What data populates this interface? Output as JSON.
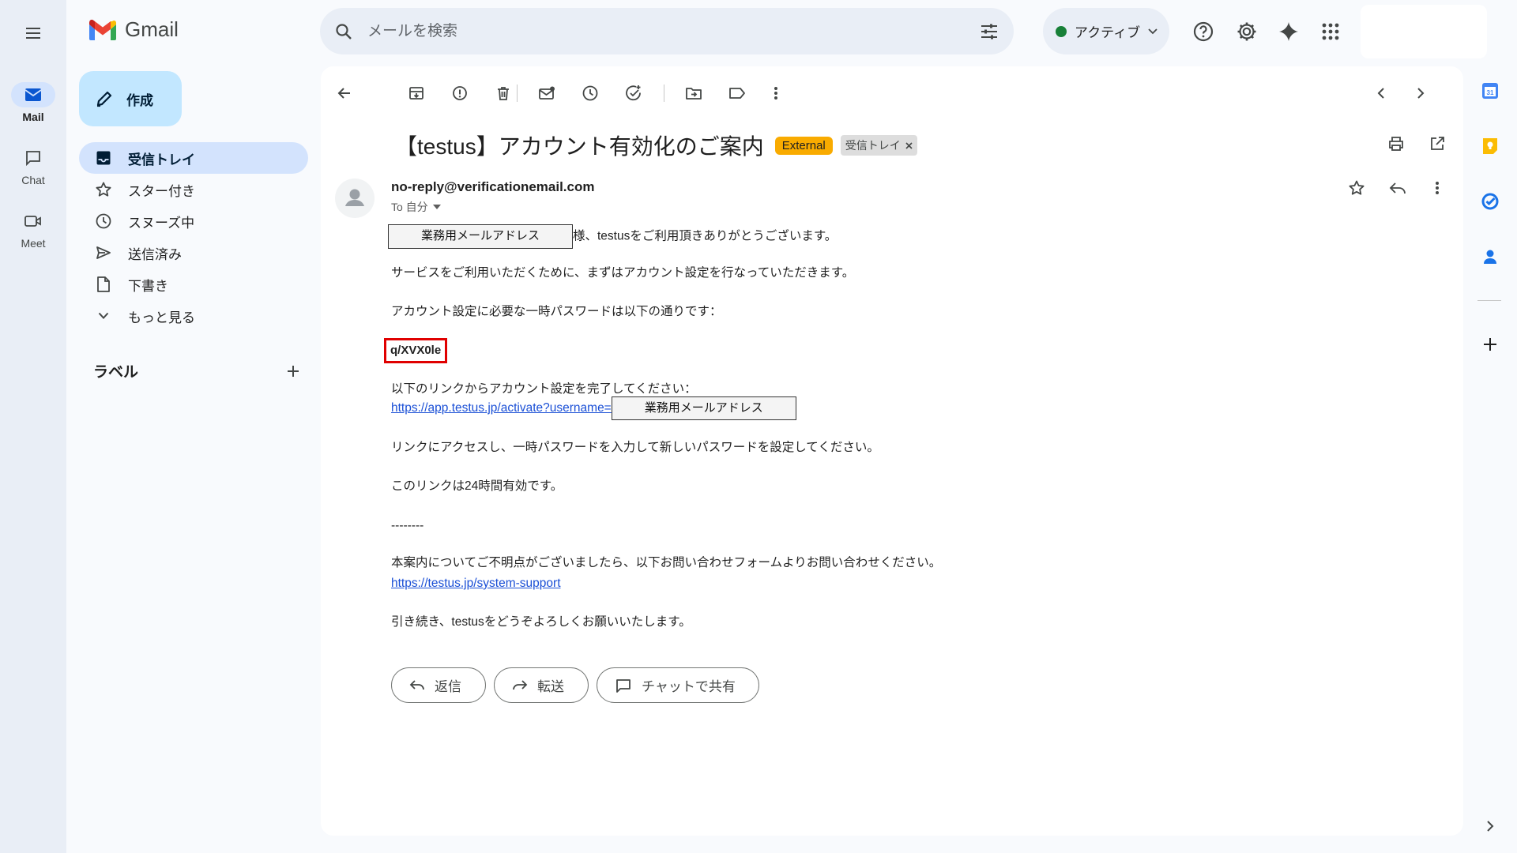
{
  "rail": {
    "items": [
      {
        "label": "Mail"
      },
      {
        "label": "Chat"
      },
      {
        "label": "Meet"
      }
    ]
  },
  "logo": {
    "text": "Gmail"
  },
  "search": {
    "placeholder": "メールを検索"
  },
  "status": {
    "label": "アクティブ",
    "color": "#188038"
  },
  "compose": {
    "label": "作成"
  },
  "nav": {
    "items": [
      {
        "label": "受信トレイ",
        "icon": "inbox-icon"
      },
      {
        "label": "スター付き",
        "icon": "star-icon"
      },
      {
        "label": "スヌーズ中",
        "icon": "clock-icon"
      },
      {
        "label": "送信済み",
        "icon": "send-icon"
      },
      {
        "label": "下書き",
        "icon": "draft-icon"
      },
      {
        "label": "もっと見る",
        "icon": "chevron-down-icon"
      }
    ]
  },
  "labels": {
    "title": "ラベル"
  },
  "email": {
    "subject": "【testus】アカウント有効化のご案内",
    "chip_external": "External",
    "chip_inbox": "受信トレイ",
    "sender": "no-reply@verificationemail.com",
    "to": "To 自分",
    "redacted_label": "業務用メールアドレス",
    "line1_suffix": "様、testusをご利用頂きありがとうございます。",
    "line2": "サービスをご利用いただくために、まずはアカウント設定を行なっていただきます。",
    "line3": "アカウント設定に必要な一時パスワードは以下の通りです：",
    "password": "q/XVX0le",
    "line4": "以下のリンクからアカウント設定を完了してください：",
    "link1": "https://app.testus.jp/activate?username=",
    "line5": "リンクにアクセスし、一時パスワードを入力して新しいパスワードを設定してください。",
    "line6": "このリンクは24時間有効です。",
    "separator": "--------",
    "line7": "本案内についてご不明点がございましたら、以下お問い合わせフォームよりお問い合わせください。",
    "link2": "https://testus.jp/system-support",
    "line8": "引き続き、testusをどうぞよろしくお願いいたします。"
  },
  "actions": {
    "reply": "返信",
    "forward": "転送",
    "share_chat": "チャットで共有"
  }
}
